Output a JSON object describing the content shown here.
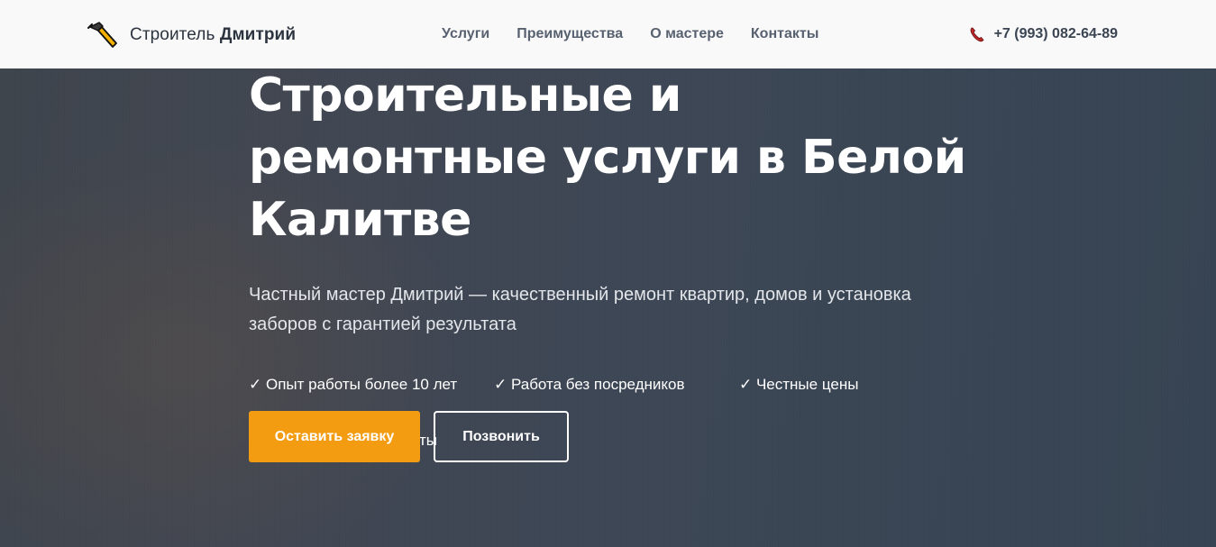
{
  "header": {
    "logo": {
      "icon": "hammer-icon",
      "text_regular": "Строитель",
      "text_bold": "Дмитрий"
    },
    "nav": [
      {
        "label": "Услуги"
      },
      {
        "label": "Преимущества"
      },
      {
        "label": "О мастере"
      },
      {
        "label": "Контакты"
      }
    ],
    "phone": {
      "icon": "phone-icon",
      "number": "+7 (993) 082-64-89"
    }
  },
  "hero": {
    "title": "Строительные и ремонтные услуги в Белой Калитве",
    "subtitle": "Частный мастер Дмитрий — качественный ремонт квартир, домов и установка заборов с гарантией результата",
    "features": [
      "✓ Опыт работы более 10 лет",
      "✓ Работа без посредников",
      "✓ Честные цены",
      "✓ Гарантия на все работы"
    ],
    "buttons": {
      "primary": "Оставить заявку",
      "secondary": "Позвонить"
    }
  },
  "colors": {
    "accent": "#f39c12",
    "header_bg": "#f9f9f9",
    "hero_bg": "#3b4654"
  }
}
